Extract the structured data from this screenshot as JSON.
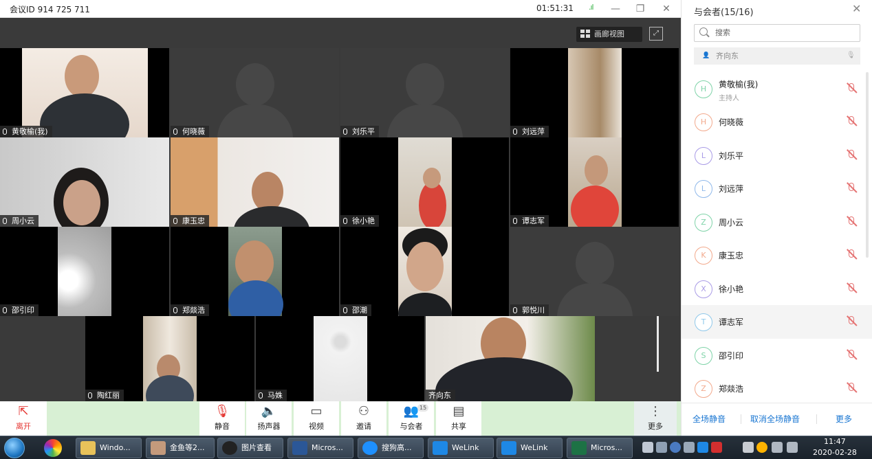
{
  "window": {
    "meeting_id": "会议ID 914 725 711",
    "timer": "01:51:31",
    "controls": {
      "minimize": "—",
      "restore": "❐",
      "close": "✕"
    }
  },
  "view": {
    "gallery_label": "画廊视图"
  },
  "video_tiles": [
    {
      "name": "黄敬榆(我)"
    },
    {
      "name": "何晓薇"
    },
    {
      "name": "刘乐平"
    },
    {
      "name": "刘远萍"
    },
    {
      "name": "周小云"
    },
    {
      "name": "康玉忠"
    },
    {
      "name": "徐小艳"
    },
    {
      "name": "谭志军"
    },
    {
      "name": "邵引印"
    },
    {
      "name": "郑燚浩"
    },
    {
      "name": "邵潮"
    },
    {
      "name": "郭悦川"
    },
    {
      "name": "陶红丽"
    },
    {
      "name": "马姝"
    },
    {
      "name": "齐向东"
    }
  ],
  "toolbar": {
    "leave": "离开",
    "mute": "静音",
    "speaker": "扬声器",
    "video": "视频",
    "invite": "邀请",
    "participants": "与会者",
    "participants_count": "15",
    "share": "共享",
    "more": "更多"
  },
  "panel": {
    "title": "与会者(15/16)",
    "search_placeholder": "搜索",
    "speaking": "齐向东",
    "participants": [
      {
        "name": "黄敬榆(我)",
        "role": "主持人",
        "initial": "H",
        "color": "#7fd3a8"
      },
      {
        "name": "何晓薇",
        "role": "",
        "initial": "H",
        "color": "#f2a98c"
      },
      {
        "name": "刘乐平",
        "role": "",
        "initial": "L",
        "color": "#a99be6"
      },
      {
        "name": "刘远萍",
        "role": "",
        "initial": "L",
        "color": "#8fb8ea"
      },
      {
        "name": "周小云",
        "role": "",
        "initial": "Z",
        "color": "#7fd3a8"
      },
      {
        "name": "康玉忠",
        "role": "",
        "initial": "K",
        "color": "#f2a98c"
      },
      {
        "name": "徐小艳",
        "role": "",
        "initial": "X",
        "color": "#a99be6"
      },
      {
        "name": "谭志军",
        "role": "",
        "initial": "T",
        "color": "#8fc8ea"
      },
      {
        "name": "邵引印",
        "role": "",
        "initial": "S",
        "color": "#7fd3a8"
      },
      {
        "name": "郑燚浩",
        "role": "",
        "initial": "Z",
        "color": "#f2a98c"
      }
    ],
    "mute_all": "全场静音",
    "unmute_all": "取消全场静音",
    "more": "更多"
  },
  "taskbar": {
    "items": [
      "Windo...",
      "金鱼等2...",
      "图片查看",
      "Micros...",
      "搜狗高...",
      "WeLink",
      "WeLink",
      "Micros..."
    ],
    "time": "11:47",
    "date": "2020-02-28"
  },
  "colors": {
    "accent": "#1976d2",
    "leave": "#e53935",
    "toolbar_bg": "#d8f0d4",
    "muted": "#e57373"
  }
}
